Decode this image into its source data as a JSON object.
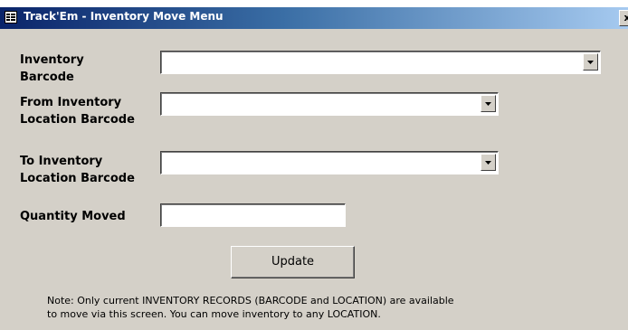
{
  "window": {
    "title": "Track'Em - Inventory Move Menu",
    "close_label": "x",
    "icon": "form-icon"
  },
  "fields": {
    "inventory_barcode": {
      "label_line1": "Inventory",
      "label_line2": "Barcode",
      "value": ""
    },
    "from_location": {
      "label_line1": "From Inventory",
      "label_line2": "Location Barcode",
      "value": ""
    },
    "to_location": {
      "label_line1": "To Inventory",
      "label_line2": "Location Barcode",
      "value": ""
    },
    "quantity_moved": {
      "label": "Quantity Moved",
      "value": ""
    }
  },
  "update_button": {
    "label": "Update"
  },
  "note": {
    "line1": "Note: Only current INVENTORY RECORDS (BARCODE and LOCATION) are available",
    "line2": "to move via this screen.  You can move inventory to any LOCATION."
  },
  "colors": {
    "form_background": "#d4d0c8",
    "titlebar_start": "#0a246a",
    "titlebar_end": "#a6caf0",
    "title_text": "#ffffff"
  },
  "icons": {
    "dropdown_arrow": "chevron-down-icon",
    "window_icon": "form-icon"
  }
}
